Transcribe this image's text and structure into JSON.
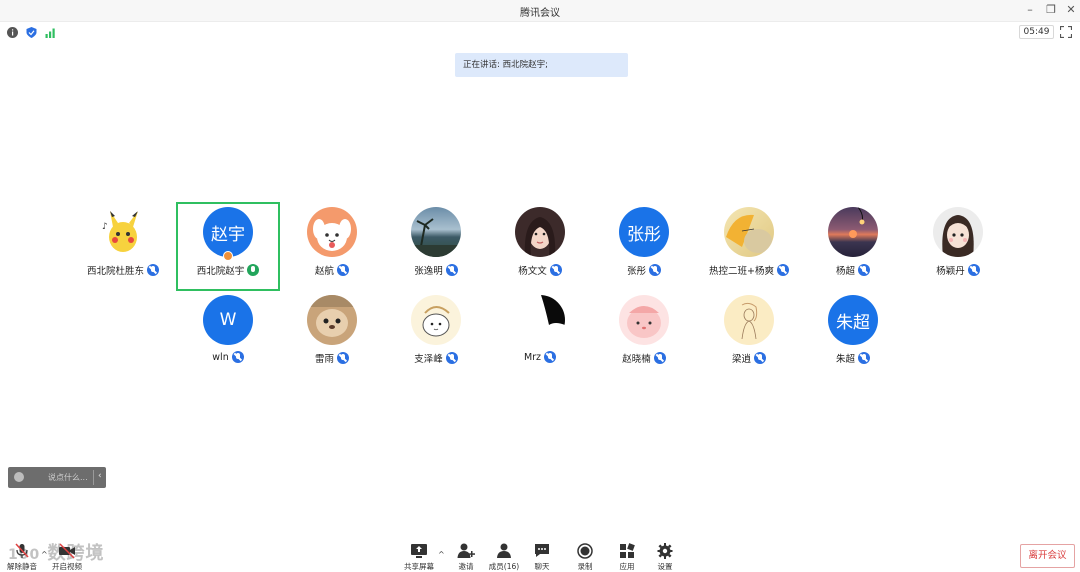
{
  "window": {
    "title": "腾讯会议"
  },
  "infobar": {
    "timer": "05:49"
  },
  "speaking": {
    "text": "正在讲话: 西北院赵宇;"
  },
  "participants": [
    {
      "name": "西北院杜胜东",
      "avatar_type": "image",
      "mic": "muted"
    },
    {
      "name": "西北院赵宇",
      "avatar_type": "text",
      "avatar_text": "赵宇",
      "mic": "active"
    },
    {
      "name": "赵航",
      "avatar_type": "image",
      "mic": "muted"
    },
    {
      "name": "张逸明",
      "avatar_type": "image",
      "mic": "muted"
    },
    {
      "name": "杨文文",
      "avatar_type": "image",
      "mic": "muted"
    },
    {
      "name": "张彤",
      "avatar_type": "text",
      "avatar_text": "张彤",
      "mic": "muted"
    },
    {
      "name": "热控二班+杨爽",
      "avatar_type": "image",
      "mic": "muted"
    },
    {
      "name": "杨超",
      "avatar_type": "image",
      "mic": "muted"
    },
    {
      "name": "杨颖丹",
      "avatar_type": "image",
      "mic": "muted"
    },
    {
      "name": "wln",
      "avatar_type": "text",
      "avatar_text": "W",
      "mic": "muted"
    },
    {
      "name": "雷雨",
      "avatar_type": "image",
      "mic": "muted"
    },
    {
      "name": "支泽峰",
      "avatar_type": "image",
      "mic": "muted"
    },
    {
      "name": "Mrz",
      "avatar_type": "image",
      "mic": "muted"
    },
    {
      "name": "赵晓楠",
      "avatar_type": "image",
      "mic": "muted"
    },
    {
      "name": "梁逍",
      "avatar_type": "image",
      "mic": "muted"
    },
    {
      "name": "朱超",
      "avatar_type": "text",
      "avatar_text": "朱超",
      "mic": "muted"
    }
  ],
  "chat": {
    "placeholder": "说点什么..."
  },
  "toolbar": {
    "unmute": "解除静音",
    "video": "开启视频",
    "share": "共享屏幕",
    "invite": "邀请",
    "members": "成员(16)",
    "chat": "聊天",
    "record": "录制",
    "apps": "应用",
    "settings": "设置",
    "leave": "离开会议"
  },
  "watermark": "数跨境",
  "colors": {
    "accent": "#2b6fe2",
    "active_frame": "#2fbf60",
    "leave": "#d93b3b"
  }
}
